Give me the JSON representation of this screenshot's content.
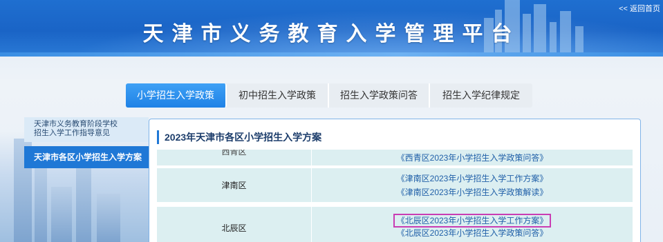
{
  "header": {
    "title": "天津市义务教育入学管理平台",
    "home_link": "<< 返回首页"
  },
  "tabs": [
    {
      "label": "小学招生入学政策",
      "active": true
    },
    {
      "label": "初中招生入学政策",
      "active": false
    },
    {
      "label": "招生入学政策问答",
      "active": false
    },
    {
      "label": "招生入学纪律规定",
      "active": false
    }
  ],
  "sidebar": {
    "items": [
      {
        "label_line1": "天津市义务教育阶段学校",
        "label_line2": "招生入学工作指导意见",
        "active": false
      },
      {
        "label": "天津市各区小学招生入学方案",
        "active": true
      }
    ]
  },
  "content": {
    "title": "2023年天津市各区小学招生入学方案",
    "rows": [
      {
        "district": "西青区",
        "links": [
          "《西青区2023年小学招生入学政策问答》"
        ]
      },
      {
        "district": "津南区",
        "links": [
          "《津南区2023年小学招生入学工作方案》",
          "《津南区2023年小学招生入学政策解读》"
        ]
      },
      {
        "district": "北辰区",
        "links": [
          "《北辰区2023年小学招生入学工作方案》",
          "《北辰区2023年小学招生入学政策问答》"
        ]
      }
    ]
  },
  "colors": {
    "header_blue": "#1a64c6",
    "tab_active": "#1f82e6",
    "sidebar_active": "#1f78d6",
    "table_row_bg": "#dceff1",
    "link_color": "#1f5fa8",
    "highlight_outline": "#c93cb3"
  }
}
